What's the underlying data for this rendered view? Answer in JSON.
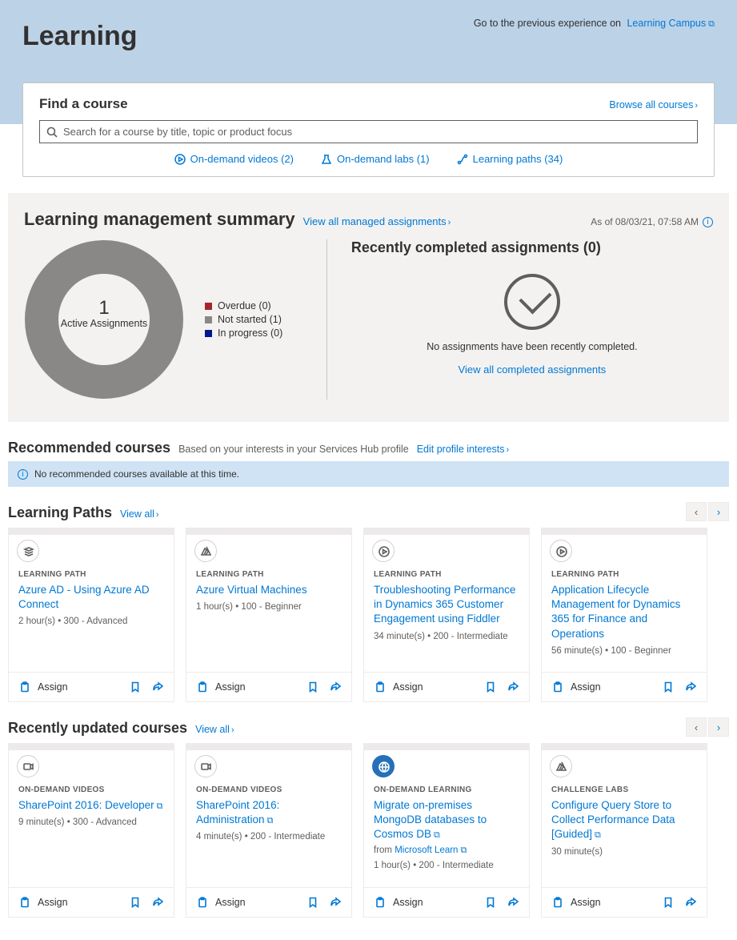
{
  "banner": {
    "prev_text": "Go to the previous experience on",
    "prev_link": "Learning Campus",
    "title": "Learning"
  },
  "find": {
    "title": "Find a course",
    "browse": "Browse all courses",
    "placeholder": "Search for a course by title, topic or product focus",
    "filters": [
      {
        "label": "On-demand videos (2)"
      },
      {
        "label": "On-demand labs (1)"
      },
      {
        "label": "Learning paths (34)"
      }
    ]
  },
  "summary": {
    "title": "Learning management summary",
    "view_link": "View all managed assignments",
    "as_of": "As of 08/03/21, 07:58 AM",
    "donut_number": "1",
    "donut_label": "Active Assignments",
    "legend": {
      "overdue": "Overdue (0)",
      "notstarted": "Not started (1)",
      "inprogress": "In progress (0)"
    },
    "recent_title": "Recently completed assignments (0)",
    "recent_msg": "No assignments have been recently completed.",
    "recent_link": "View all completed assignments"
  },
  "recommended": {
    "title": "Recommended courses",
    "subtitle": "Based on your interests in your Services Hub profile",
    "edit_link": "Edit profile interests",
    "empty_msg": "No recommended courses available at this time."
  },
  "paths": {
    "title": "Learning Paths",
    "view_all": "View all",
    "cards": [
      {
        "type": "LEARNING PATH",
        "title": "Azure AD - Using Azure AD Connect",
        "meta": "2 hour(s)  •  300 - Advanced"
      },
      {
        "type": "LEARNING PATH",
        "title": "Azure Virtual Machines",
        "meta": "1 hour(s)  •  100 - Beginner"
      },
      {
        "type": "LEARNING PATH",
        "title": "Troubleshooting Performance in Dynamics 365 Customer Engagement using Fiddler",
        "meta": "34 minute(s)  •  200 - Intermediate"
      },
      {
        "type": "LEARNING PATH",
        "title": "Application Lifecycle Management for Dynamics 365 for Finance and Operations",
        "meta": "56 minute(s)  •  100 - Beginner"
      }
    ]
  },
  "recent": {
    "title": "Recently updated courses",
    "view_all": "View all",
    "cards": [
      {
        "type": "ON-DEMAND VIDEOS",
        "title": "SharePoint 2016: Developer",
        "ext": true,
        "meta": "9 minute(s)  •  300 - Advanced",
        "from": ""
      },
      {
        "type": "ON-DEMAND VIDEOS",
        "title": "SharePoint 2016: Administration",
        "ext": true,
        "meta": "4 minute(s)  •  200 - Intermediate",
        "from": ""
      },
      {
        "type": "ON-DEMAND LEARNING",
        "title": "Migrate on-premises MongoDB databases to Cosmos DB",
        "ext": true,
        "meta": "1 hour(s)  •  200 - Intermediate",
        "from": "Microsoft Learn"
      },
      {
        "type": "CHALLENGE LABS",
        "title": "Configure Query Store to Collect Performance Data [Guided]",
        "ext": true,
        "meta": "30 minute(s)",
        "from": ""
      }
    ]
  },
  "assign_label": "Assign",
  "chart_data": {
    "type": "pie",
    "title": "Active Assignments",
    "series": [
      {
        "name": "Overdue",
        "value": 0,
        "color": "#a4262c"
      },
      {
        "name": "Not started",
        "value": 1,
        "color": "#8a8886"
      },
      {
        "name": "In progress",
        "value": 0,
        "color": "#00188f"
      }
    ],
    "total": 1
  }
}
